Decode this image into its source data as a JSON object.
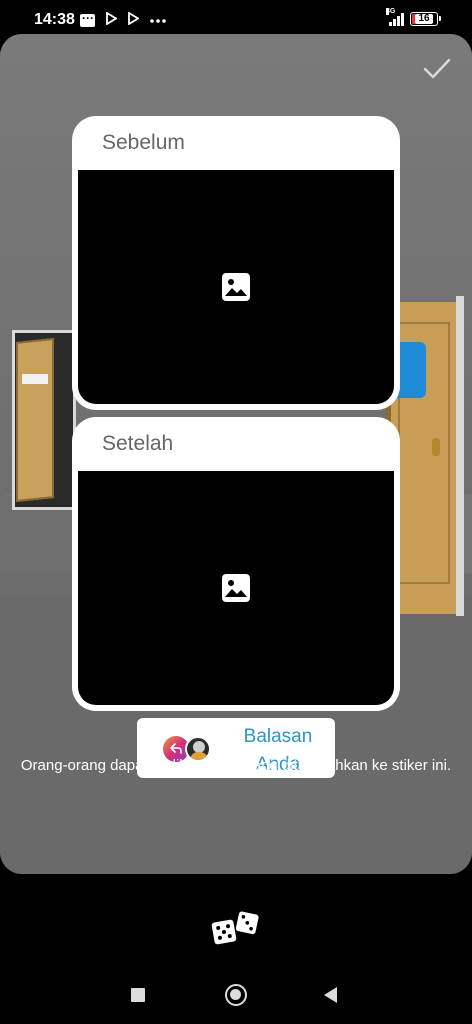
{
  "status_bar": {
    "time": "14:38",
    "network": "4G",
    "battery": "16",
    "battery_level": 0.16,
    "icons": [
      "message-icon",
      "play-icon",
      "play-icon",
      "more-dots-icon",
      "signal-icon",
      "battery-icon"
    ]
  },
  "toolbar": {
    "done_icon": "checkmark-icon"
  },
  "stickers": {
    "before_label": "Sebelum",
    "after_label": "Setelah",
    "placeholder_icon": "image-placeholder-icon"
  },
  "reply_sticker": {
    "line1": "Balasan",
    "line2": "Anda"
  },
  "info_text": "Orang-orang dapat melihat cerita yang ditambahkan ke stiker ini.",
  "bottom": {
    "dice_icon": "dice-icon"
  },
  "colors": {
    "panel_bg": "#ffffff",
    "media_bg": "#000000",
    "reply_text": "#2b95c9",
    "battery_low": "#e53935"
  }
}
